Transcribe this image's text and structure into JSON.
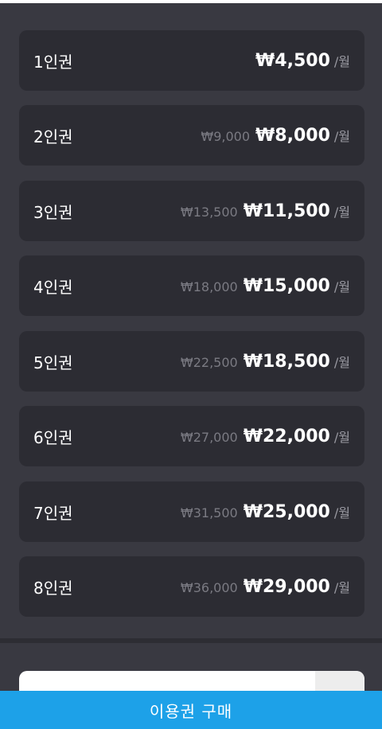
{
  "plans": [
    {
      "name": "1인권",
      "original": "",
      "price": "₩4,500",
      "unit": "/월"
    },
    {
      "name": "2인권",
      "original": "₩9,000",
      "price": "₩8,000",
      "unit": "/월"
    },
    {
      "name": "3인권",
      "original": "₩13,500",
      "price": "₩11,500",
      "unit": "/월"
    },
    {
      "name": "4인권",
      "original": "₩18,000",
      "price": "₩15,000",
      "unit": "/월"
    },
    {
      "name": "5인권",
      "original": "₩22,500",
      "price": "₩18,500",
      "unit": "/월"
    },
    {
      "name": "6인권",
      "original": "₩27,000",
      "price": "₩22,000",
      "unit": "/월"
    },
    {
      "name": "7인권",
      "original": "₩31,500",
      "price": "₩25,000",
      "unit": "/월"
    },
    {
      "name": "8인권",
      "original": "₩36,000",
      "price": "₩29,000",
      "unit": "/월"
    }
  ],
  "purchase_button": {
    "label": "이용권 구매"
  },
  "colors": {
    "background": "#393941",
    "card": "#2c2c33",
    "accent": "#1da1e8",
    "muted_text": "#7a7a82"
  }
}
